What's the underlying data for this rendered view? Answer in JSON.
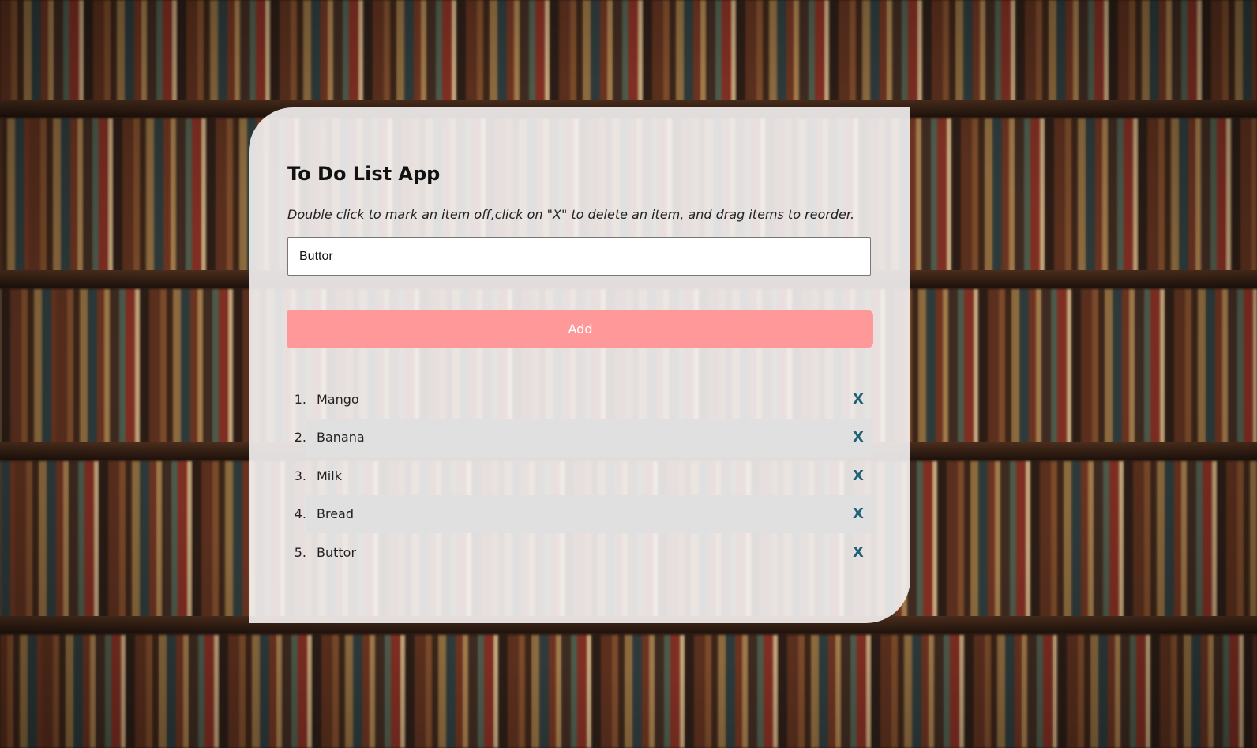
{
  "app": {
    "title": "To Do List App",
    "instructions": "Double click to mark an item off,click on \"X\" to delete an item, and drag items to reorder."
  },
  "input": {
    "value": "Buttor",
    "placeholder": ""
  },
  "add_button": {
    "label": "Add"
  },
  "todo": {
    "delete_label": "X",
    "items": [
      {
        "number": "1.",
        "text": "Mango"
      },
      {
        "number": "2.",
        "text": "Banana"
      },
      {
        "number": "3.",
        "text": "Milk"
      },
      {
        "number": "4.",
        "text": "Bread"
      },
      {
        "number": "5.",
        "text": "Buttor"
      }
    ]
  },
  "colors": {
    "accent_button": "#ff9999",
    "delete_x": "#1d6276",
    "alternate_row": "#e0e0e0",
    "card_background": "#f5f3f3"
  },
  "background": {
    "icon": "bookshelf-background"
  }
}
